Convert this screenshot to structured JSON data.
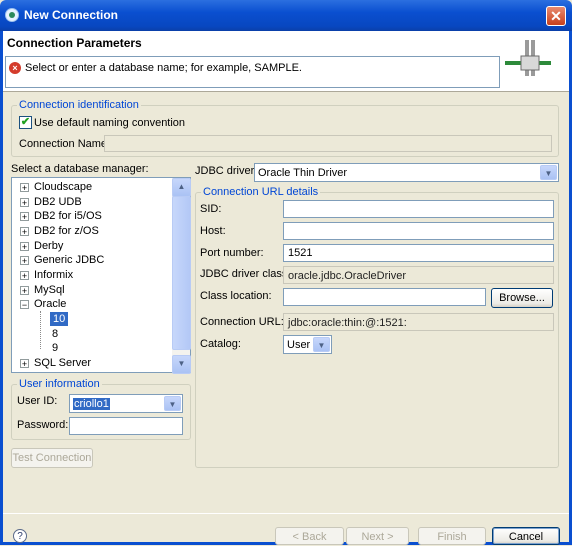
{
  "window": {
    "title": "New Connection",
    "close_glyph": "✕"
  },
  "header": {
    "title": "Connection Parameters",
    "message": "Select or enter a database name; for example, SAMPLE.",
    "message_icon": "error-icon",
    "banner_icon": "database-connection-banner-icon"
  },
  "identification": {
    "legend": "Connection identification",
    "use_default_label": "Use default naming convention",
    "use_default_checked": true,
    "check_glyph": "✔",
    "name_label": "Connection Name:",
    "name_value": ""
  },
  "db_manager": {
    "label": "Select a database manager:",
    "items": [
      {
        "label": "Cloudscape",
        "expander": "+"
      },
      {
        "label": "DB2 UDB",
        "expander": "+"
      },
      {
        "label": "DB2 for i5/OS",
        "expander": "+"
      },
      {
        "label": "DB2 for z/OS",
        "expander": "+"
      },
      {
        "label": "Derby",
        "expander": "+"
      },
      {
        "label": "Generic JDBC",
        "expander": "+"
      },
      {
        "label": "Informix",
        "expander": "+"
      },
      {
        "label": "MySql",
        "expander": "+"
      },
      {
        "label": "Oracle",
        "expander": "−"
      },
      {
        "label": "10",
        "selected": true
      },
      {
        "label": "8"
      },
      {
        "label": "9"
      },
      {
        "label": "SQL Server",
        "expander": "+"
      }
    ],
    "scroll_up": "▲",
    "scroll_down": "▼"
  },
  "user_info": {
    "legend": "User information",
    "user_label": "User ID:",
    "user_value": "criollo1",
    "password_label": "Password:",
    "password_value": ""
  },
  "test_button": "Test Connection",
  "jdbc": {
    "driver_label": "JDBC driver:",
    "driver_value": "Oracle Thin Driver",
    "dropdown_glyph": "▼"
  },
  "url_details": {
    "legend": "Connection URL details",
    "sid_label": "SID:",
    "sid_value": "",
    "host_label": "Host:",
    "host_value": "",
    "port_label": "Port number:",
    "port_value": "1521",
    "driver_class_label": "JDBC driver class:",
    "driver_class_value": "oracle.jdbc.OracleDriver",
    "class_location_label": "Class location:",
    "class_location_value": "",
    "browse_label": "Browse...",
    "url_label": "Connection URL:",
    "url_value": "jdbc:oracle:thin:@:1521:",
    "catalog_label": "Catalog:",
    "catalog_value": "User"
  },
  "footer": {
    "help_glyph": "?",
    "back_label": "< Back",
    "next_label": "Next >",
    "finish_label": "Finish",
    "cancel_label": "Cancel"
  },
  "colors": {
    "titlebar": "#0a4fd0",
    "dialog_bg": "#ece9d8",
    "legend_text": "#0046d5",
    "selection": "#316ac5",
    "error": "#d43c2c"
  }
}
